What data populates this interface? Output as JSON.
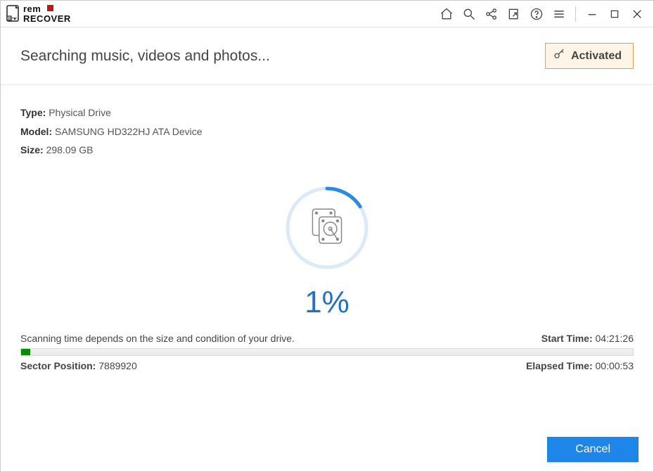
{
  "app": {
    "brand_top": "rem",
    "brand_bottom": "RECOVER"
  },
  "header": {
    "title": "Searching music, videos and photos...",
    "activated_label": "Activated"
  },
  "drive": {
    "type_label": "Type:",
    "type_value": "Physical Drive",
    "model_label": "Model:",
    "model_value": "SAMSUNG HD322HJ ATA Device",
    "size_label": "Size:",
    "size_value": "298.09 GB"
  },
  "progress": {
    "percent": "1%",
    "percent_num": 1,
    "ring_dashoffset": 296
  },
  "scan": {
    "note": "Scanning time depends on the size and condition of your drive.",
    "start_time_label": "Start Time:",
    "start_time_value": "04:21:26",
    "sector_label": "Sector Position:",
    "sector_value": "7889920",
    "elapsed_label": "Elapsed Time:",
    "elapsed_value": "00:00:53",
    "bar_fill_width": "1.5%"
  },
  "footer": {
    "cancel_label": "Cancel"
  }
}
